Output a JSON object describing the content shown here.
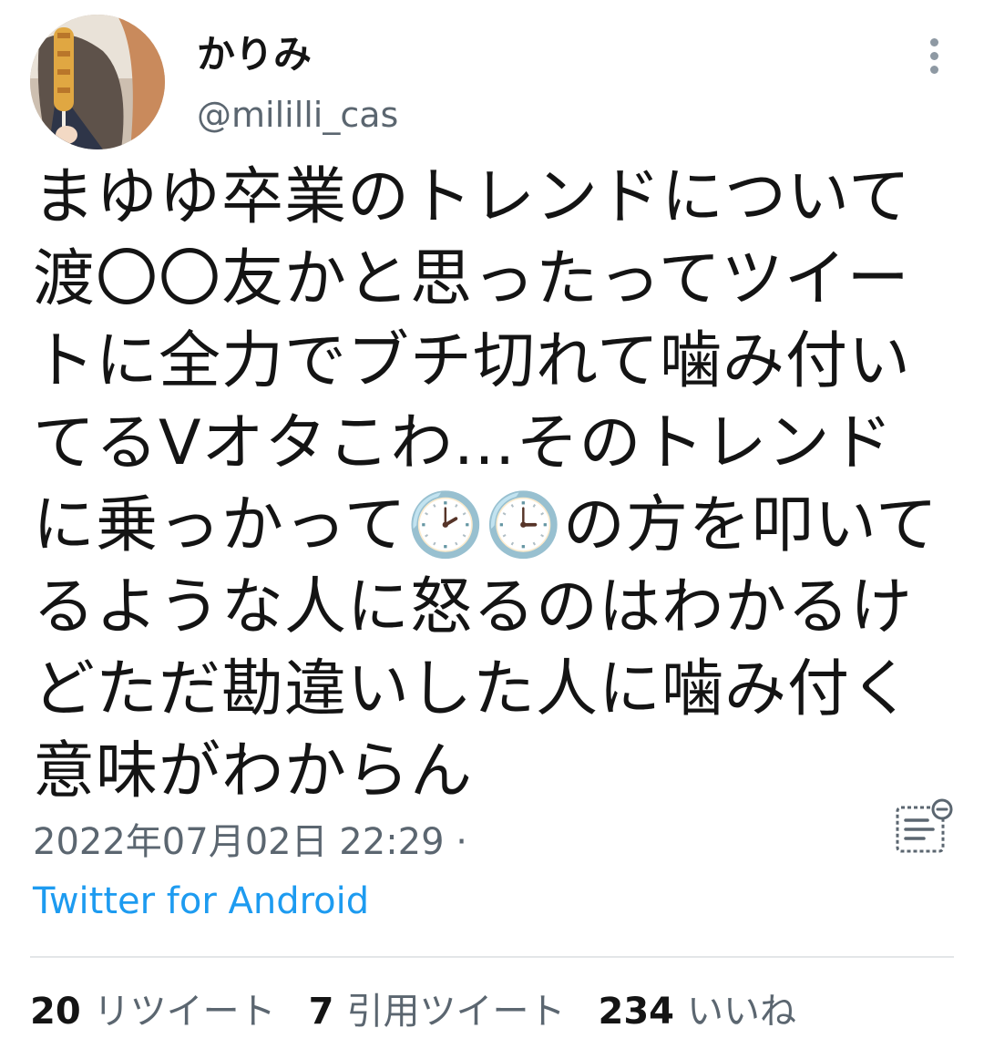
{
  "user": {
    "display_name": "かりみ",
    "handle": "@mililli_cas"
  },
  "tweet": {
    "text": "まゆゆ卒業のトレンドについて渡〇〇友かと思ったってツイートに全力でブチ切れて噛み付いてるVオタこわ…そのトレンドに乗っかって🕑🕒の方を叩いてるような人に怒るのはわかるけどただ勘違いした人に噛み付く意味がわからん",
    "timestamp": "2022年07月02日 22:29 ·",
    "client": "Twitter for Android"
  },
  "stats": [
    {
      "count": "20",
      "label": "リツイート"
    },
    {
      "count": "7",
      "label": "引用ツイート"
    },
    {
      "count": "234",
      "label": "いいね"
    }
  ],
  "icons": {
    "more": "more-vertical-icon",
    "notes": "notes-minus-icon"
  },
  "colors": {
    "link": "#1d9bf0",
    "secondary_text": "#5b6670"
  }
}
